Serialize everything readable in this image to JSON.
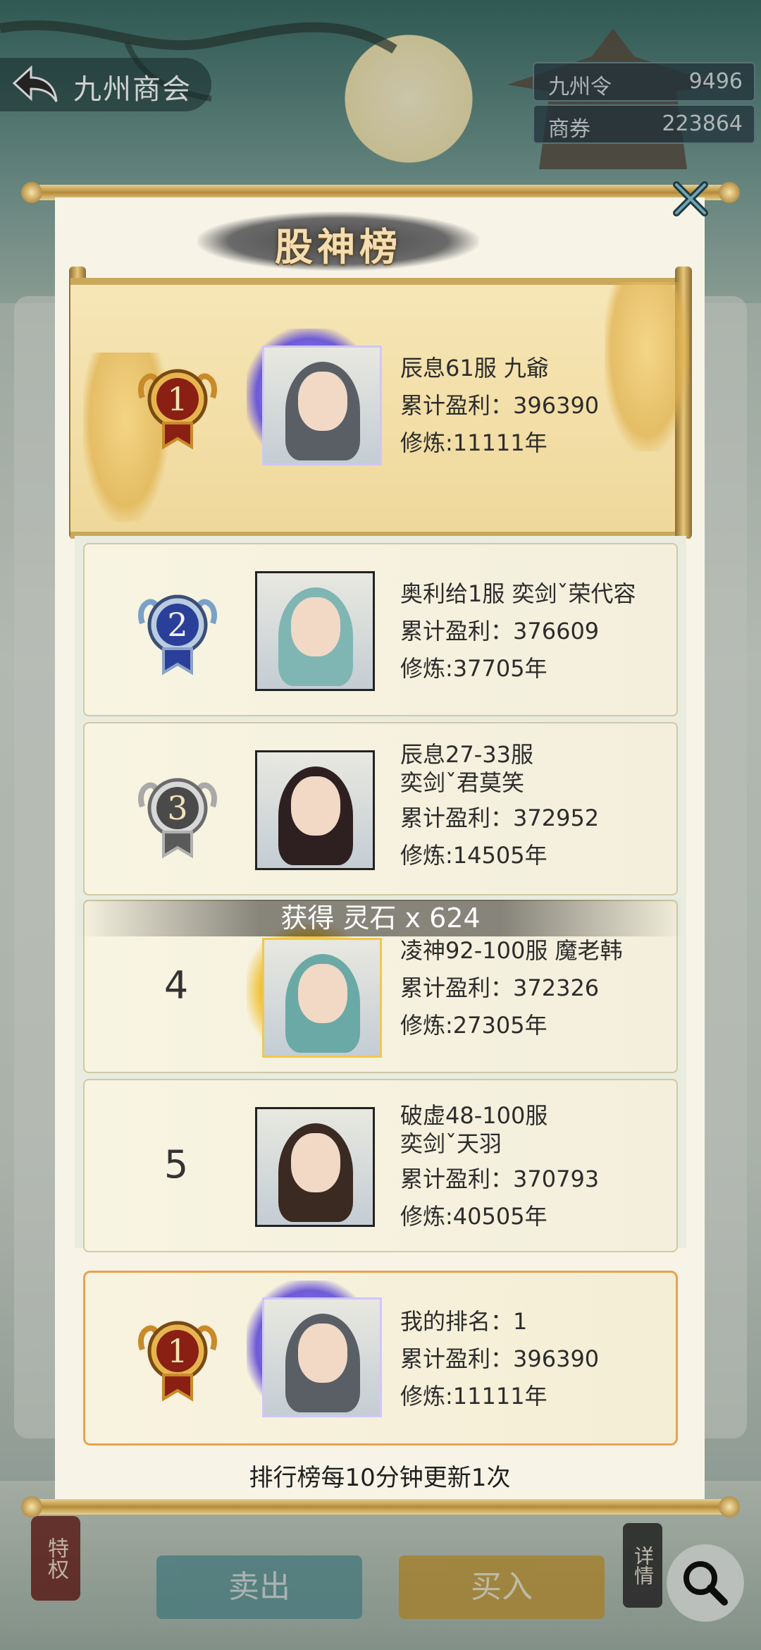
{
  "header": {
    "title": "九州商会",
    "currencies": [
      {
        "label": "九州令",
        "value": "9496"
      },
      {
        "label": "商券",
        "value": "223864"
      }
    ]
  },
  "leaderboard": {
    "title": "股神榜",
    "entries": [
      {
        "rank": "1",
        "name_lines": [
          "辰息61服 九爺"
        ],
        "profit": "累计盈利：396390",
        "cultivation": "修炼:11111年"
      },
      {
        "rank": "2",
        "name_lines": [
          "奥利给1服 奕剑ˇ荣代容"
        ],
        "profit": "累计盈利：376609",
        "cultivation": "修炼:37705年"
      },
      {
        "rank": "3",
        "name_lines": [
          "辰息27-33服",
          "奕剑ˇ君莫笑"
        ],
        "profit": "累计盈利：372952",
        "cultivation": "修炼:14505年"
      },
      {
        "rank": "4",
        "name_lines": [
          "凌神92-100服 魔老韩"
        ],
        "profit": "累计盈利：372326",
        "cultivation": "修炼:27305年"
      },
      {
        "rank": "5",
        "name_lines": [
          "破虚48-100服",
          "奕剑ˇ天羽"
        ],
        "profit": "累计盈利：370793",
        "cultivation": "修炼:40505年"
      }
    ],
    "my_rank": {
      "rank": "1",
      "label": "我的排名：1",
      "profit": "累计盈利：396390",
      "cultivation": "修炼:11111年"
    },
    "footer_note": "排行榜每10分钟更新1次"
  },
  "toast": "获得 灵石 x 624",
  "bottom_bar": {
    "privilege_label": "特权",
    "sell_label": "卖出",
    "buy_label": "买入",
    "details_label": "详情"
  },
  "icons": [
    "back-icon",
    "close-icon",
    "search-icon",
    "rank-badge-gold-icon",
    "rank-badge-blue-icon",
    "rank-badge-silver-icon"
  ],
  "colors": {
    "gold": "#c9a85c",
    "accent_orange": "#e8a24f",
    "teal": "#4c8e94"
  }
}
